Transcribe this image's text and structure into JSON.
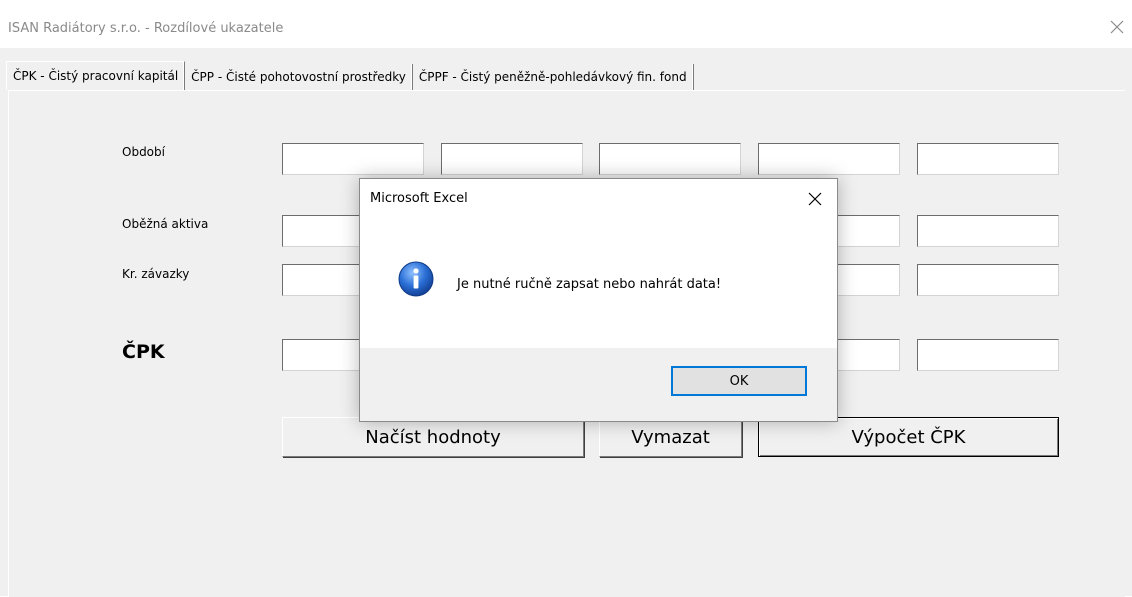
{
  "window": {
    "title": "ISAN Radiátory s.r.o. - Rozdílové ukazatele"
  },
  "tabs": [
    {
      "label": "ČPK - Čistý pracovní kapitál",
      "active": true
    },
    {
      "label": "ČPP - Čisté pohotovostní prostředky",
      "active": false
    },
    {
      "label": "ČPPF - Čistý peněžně-pohledávkový fin. fond",
      "active": false
    }
  ],
  "form": {
    "labels": {
      "period": "Období",
      "current_assets": "Oběžná aktiva",
      "short_liabilities": "Kr. závazky",
      "cpk": "ČPK"
    },
    "buttons": {
      "load": "Načíst hodnoty",
      "clear": "Vymazat",
      "calculate": "Výpočet ČPK"
    }
  },
  "dialog": {
    "title": "Microsoft Excel",
    "message": "Je nutné ručně zapsat nebo nahrát data!",
    "ok_label": "OK",
    "icon": "info-icon"
  },
  "colors": {
    "info_blue": "#1c63c4",
    "focus_blue": "#0078d7"
  }
}
